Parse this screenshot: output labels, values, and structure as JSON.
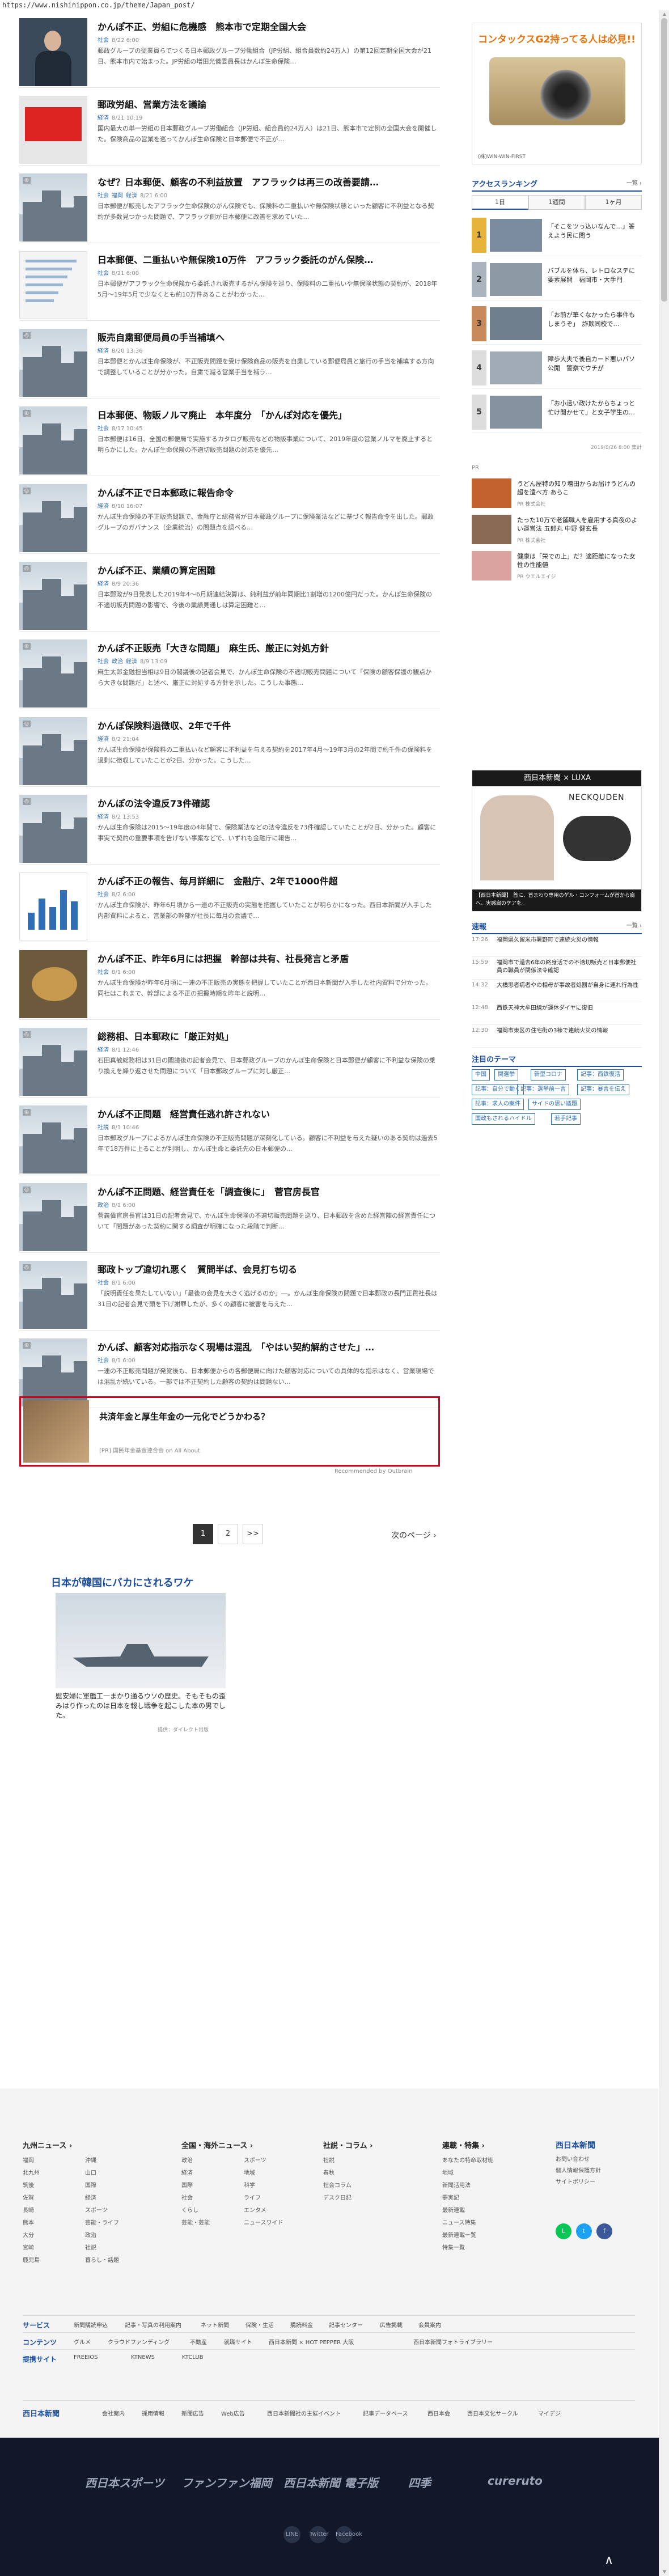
{
  "url": "https://www.nishinippon.co.jp/theme/Japan_post/",
  "articles": [
    {
      "title": "かんぽ不正、労組に危機感　熊本市で定期全国大会",
      "tags": [
        "社会"
      ],
      "date": "8/22 6:00",
      "body": "郵政グループの従業員らでつくる日本郵政グループ労働組合（JP労組、組合員数約24万人）の第12回定期全国大会が21日、熊本市内で始まった。JP労組の増田光儀委員長はかんぽ生命保険…",
      "thumb": "person"
    },
    {
      "title": "郵政労組、営業方法を議論",
      "tags": [
        "経済"
      ],
      "date": "8/21 10:19",
      "body": "国内最大の単一労組の日本郵政グループ労働組合（JP労組、組合員約24万人）は21日、熊本市で定例の全国大会を開催した。保険商品の営業を巡ってかんぽ生命保険と日本郵便で不正が…",
      "thumb": "red"
    },
    {
      "title": "なぜ？日本郵便、顧客の不利益放置　アフラックは再三の改善要請…",
      "tags": [
        "社会",
        "福岡",
        "経済"
      ],
      "date": "8/21 6:00",
      "body": "日本郵便が販売したアフラック生命保険のがん保険でも、保険料の二重払いや無保険状態といった顧客に不利益となる契約が多数見つかった問題で、アフラック側が日本郵便に改善を求めていた…",
      "thumb": "city"
    },
    {
      "title": "日本郵便、二重払いや無保険10万件　アフラック委託のがん保険…",
      "tags": [
        "社会"
      ],
      "date": "8/21 6:00",
      "body": "日本郵便がアフラック生命保険から委託され販売するがん保険を巡り、保険料の二重払いや無保険状態の契約が、2018年5月～19年5月で少なくとも約10万件あることがわかった…",
      "thumb": "doc"
    },
    {
      "title": "販売自粛郵便局員の手当補填へ",
      "tags": [
        "経済"
      ],
      "date": "8/20 13:36",
      "body": "日本郵便とかんぽ生命保険が、不正販売問題を受け保険商品の販売を自粛している郵便局員と旅行の手当を補填する方向で調整していることが分かった。自粛で減る営業手当を補う…",
      "thumb": "city"
    },
    {
      "title": "日本郵便、物販ノルマ廃止　本年度分　「かんぽ対応を優先」",
      "tags": [
        "社会"
      ],
      "date": "8/17 10:45",
      "body": "日本郵便は16日、全国の郵便局で実施するカタログ販売などの物販事業について、2019年度の営業ノルマを廃止すると明らかにした。かんぽ生命保険の不適切販売問題の対応を優先…",
      "thumb": "city"
    },
    {
      "title": "かんぽ不正で日本郵政に報告命令",
      "tags": [
        "経済"
      ],
      "date": "8/10 16:07",
      "body": "かんぽ生命保険の不正販売問題で、金融庁と総務省が日本郵政グループに保険業法などに基づく報告命令を出した。郵政グループのガバナンス（企業統治）の問題点を調べる…",
      "thumb": "city"
    },
    {
      "title": "かんぽ不正、業績の算定困難",
      "tags": [
        "経済"
      ],
      "date": "8/9 20:36",
      "body": "日本郵政が9日発表した2019年4～6月期連結決算は、純利益が前年同期比1割増の1200億円だった。かんぽ生命保険の不適切販売問題の影響で、今後の業績見通しは算定困難と…",
      "thumb": "city"
    },
    {
      "title": "かんぽ不正販売「大きな問題」　麻生氏、厳正に対処方針",
      "tags": [
        "社会",
        "政治",
        "経済"
      ],
      "date": "8/9 13:09",
      "body": "麻生太郎金融担当相は9日の閣議後の記者会見で、かんぽ生命保険の不適切販売問題について「保険の顧客保護の観点から大きな問題だ」と述べ、厳正に対処する方針を示した。こうした事態…",
      "thumb": "city"
    },
    {
      "title": "かんぽ保険料過徴収、2年で千件",
      "tags": [
        "経済"
      ],
      "date": "8/2 21:04",
      "body": "かんぽ生命保険が保険料の二重払いなど顧客に不利益を与える契約を2017年4月～19年3月の2年間で約千件の保険料を過剰に徴収していたことが2日、分かった。こうした…",
      "thumb": "city"
    },
    {
      "title": "かんぽの法令違反73件確認",
      "tags": [
        "経済"
      ],
      "date": "8/2 13:53",
      "body": "かんぽ生命保険は2015～19年度の4年間で、保険業法などの法令違反を73件確認していたことが2日、分かった。顧客に事実で契約の重要事項を告げない事案などで、いずれも金融庁に報告…",
      "thumb": "city"
    },
    {
      "title": "かんぽ不正の報告、毎月詳細に　金融庁、2年で1000件超",
      "tags": [
        "社会"
      ],
      "date": "8/2 6:00",
      "body": "かんぽ生命保険が、昨年6月頃から一連の不正販売の実態を把握していたことが明らかになった。西日本新聞が入手した内部資料によると、営業部の幹部が社長に毎月の会議で…",
      "thumb": "chart"
    },
    {
      "title": "かんぽ不正、昨年6月には把握　幹部は共有、社長発言と矛盾",
      "tags": [
        "社会"
      ],
      "date": "8/1 6:00",
      "body": "かんぽ生命保険が昨年6月頃に一連の不正販売の実態を把握していたことが西日本新聞が入手した社内資料で分かった。同社はこれまで、幹部による不正の把握時期を昨年と説明…",
      "thumb": "gold"
    },
    {
      "title": "総務相、日本郵政に「厳正対処」",
      "tags": [
        "経済"
      ],
      "date": "8/1 12:46",
      "body": "石田真敏総務相は31日の閣議後の記者会見で、日本郵政グループのかんぽ生命保険と日本郵便が顧客に不利益な保険の乗り換えを繰り返させた問題について「日本郵政グループに対し厳正…",
      "thumb": "city"
    },
    {
      "title": "かんぽ不正問題　経営責任逃れ許されない",
      "tags": [
        "社説"
      ],
      "date": "8/1 10:46",
      "body": "日本郵政グループによるかんぽ生命保険の不正販売問題が深刻化している。顧客に不利益を与えた疑いのある契約は過去5年で18万件に上ることが判明し、かんぽ生命と委託先の日本郵便の…",
      "thumb": "city"
    },
    {
      "title": "かんぽ不正問題、経営責任を「調査後に」　菅官房長官",
      "tags": [
        "政治"
      ],
      "date": "8/1 6:00",
      "body": "菅義偉官房長官は31日の記者会見で、かんぽ生命保険の不適切販売問題を巡り、日本郵政を含めた経営陣の経営責任について「問題があった契約に関する調査が明確になった段階で判断…",
      "thumb": "city"
    },
    {
      "title": "郵政トップ違切れ悪く　質問半ば、会見打ち切る",
      "tags": [
        "社会"
      ],
      "date": "8/1 6:00",
      "body": "「説明責任を果たしていない」「最後の会見を大きく逃げるのか」―。かんぽ生命保険の問題で日本郵政の長門正貢社長は31日の記者会見で頭を下げ謝罪したが、多くの顧客に被害を与えた…",
      "thumb": "city"
    },
    {
      "title": "かんぽ、顧客対応指示なく現場は混乱　「やはい契約解約させた」…",
      "tags": [
        "社会"
      ],
      "date": "8/1 6:00",
      "body": "一連の不正販売問題が発覚後も、日本郵便からの各郵便局に向けた顧客対応についての具体的な指示はなく、営業現場では混乱が続いている。一部では不正契約した顧客の契約は問題ない…",
      "thumb": "city"
    }
  ],
  "promo": {
    "title": "共済年金と厚生年金の一元化でどうかわる？",
    "source": "[PR] 国民年金基金連合会 on All About",
    "recommended": "Recommended by Outbrain"
  },
  "pager": {
    "pages": [
      "1",
      "2",
      ">>"
    ],
    "active": "1",
    "next": "次のページ ›"
  },
  "dia_ad": {
    "title": "日本が韓国にバカにされるワケ",
    "caption": "慰安婦に軍艦工一まかり通るウソの歴史。そもそもの歪みはり作ったのは日本を報し戦争を起こした本の男でした。",
    "source": "提供：ダイレクト出版"
  },
  "side": {
    "ad_text": "コンタックスG2持ってる人は必見!!",
    "ad_brand": "(株)WIN-WIN-FIRST",
    "ranking_title": "アクセスランキング",
    "ranking_more": "一覧 ›",
    "ranking_tabs": [
      "1日",
      "1週間",
      "1ヶ月"
    ],
    "ranking": [
      {
        "num": "1",
        "text": "「そこをツっ込いなんで…」答えよう民に問う"
      },
      {
        "num": "2",
        "text": "バブルを体ち、レトロなステに要素展開　福岡市・大手門"
      },
      {
        "num": "3",
        "text": "「お前が筆くなかったら事件もしまうぞ」　詐欺同校で…"
      },
      {
        "num": "4",
        "text": "障歩大夫で後自カード悪いパソ公開　警察でウチが"
      },
      {
        "num": "5",
        "text": "「お小遣い政けたからちょっと忙け聞かせて」と女子学生の…"
      }
    ],
    "ranking_date": "2019/8/26 8:00 集計",
    "pr_label": "PR",
    "pr": [
      {
        "text": "うどん屋特の知り増田からお届けうどんの超を遺べ方 あらこ",
        "src": "PR 株式会社"
      },
      {
        "text": "たった10万で老舗職人を雇用する真夜のよい運営法 五郎丸 中野 健玄長",
        "src": "PR 株式会社"
      },
      {
        "text": "健康は「栄での上」だ？適距離になった女性の性能値",
        "src": "PR ウエルエイジ"
      }
    ],
    "luxa_brand": "西日本新聞 × LUXA",
    "luxa_neck": "NECKQUDEN",
    "luxa_foot": "【西日本新聞】 首に、首まわり専用のゲル・コンフォームが首から肩へ、実感肩のケアを。",
    "flash_title": "速報",
    "flash_more": "一覧 ›",
    "flash": [
      {
        "time": "17:26",
        "text": "福岡県久留米市署野町で連続火災の情報"
      },
      {
        "time": "15:59",
        "text": "福岡市で過去6年の終身活での不適切販売と日本郵便社員の職員が関係法令確認"
      },
      {
        "time": "14:32",
        "text": "大橋思者病者やの相母が事故者処罰が自身に連れ行為性"
      },
      {
        "time": "12:48",
        "text": "西鉄天神大牟田線が運休ダイヤに復旧"
      },
      {
        "time": "12:30",
        "text": "福岡市東区の住宅街の3棟で連続火災の情報"
      }
    ],
    "theme_title": "注目のテーマ",
    "themes": [
      "中国",
      "関選挙",
      "新型コロナ",
      "記事：西鉄復活",
      "記事：自分で動く",
      "記事：選挙前一言",
      "記事：暴言を伝え",
      "記事：求人の案件",
      "サイドの思い議題",
      "国政もされるハイドル",
      "若手記事"
    ]
  },
  "footer": {
    "cols": [
      {
        "title": "九州ニュース ›",
        "links": [
          "福岡",
          "北九州",
          "筑後",
          "佐賀",
          "長崎",
          "熊本",
          "大分",
          "宮崎",
          "鹿児島",
          "沖縄",
          "山口",
          "国際",
          "経済",
          "スポーツ",
          "芸能・ライフ",
          "政治",
          "社説",
          "暮らし・話題"
        ]
      },
      {
        "title": "全国・海外ニュース ›",
        "links": [
          "政治",
          "経済",
          "国際",
          "社会",
          "くらし",
          "芸能・芸能",
          "スポーツ",
          "地域",
          "科学",
          "ライフ",
          "エンタメ",
          "ニュースワイド"
        ]
      },
      {
        "title": "社説・コラム ›",
        "links": [
          "社説",
          "春秋",
          "社会コラム",
          "デスク日記"
        ]
      },
      {
        "title": "連載・特集 ›",
        "links": [
          "あなたの特命取材班",
          "地域",
          "新聞活用法",
          "夢実記",
          "最新連載",
          "ニュース特集",
          "最新連載一覧",
          "特集一覧"
        ]
      }
    ],
    "logo": "西日本新聞",
    "logo_links": [
      "お問い合わせ",
      "個人情報保護方針",
      "サイトポリシー"
    ],
    "service_title": "サービス",
    "service_links": [
      "新聞購読申込",
      "記事・写真の利用案内",
      "ネット新聞",
      "保険・生活",
      "購読料金",
      "記事センター",
      "広告掲載",
      "会員案内"
    ],
    "content_title": "コンテンツ",
    "content_links": [
      "グルメ",
      "クラウドファンディング",
      "不動産",
      "就職サイト",
      "西日本新聞 × HOT PEPPER 大阪",
      "西日本新聞フォトライブラリー"
    ],
    "site_title": "提携サイト",
    "site_links": [
      "FREEIOS",
      "KTNEWS",
      "KTCLUB"
    ],
    "bottom_logo": "西日本新聞",
    "bottom_links": [
      "会社案内",
      "採用情報",
      "新聞広告",
      "Web広告",
      "西日本新聞社の主催イベント",
      "記事データベース",
      "西日本会",
      "西日本文化サークル",
      "マイデジ"
    ],
    "dark_logos": [
      "西日本スポーツ",
      "ファンファン福岡",
      "西日本新聞 電子版",
      "四季",
      "cureruto"
    ],
    "dark_sns": [
      "LINE",
      "Twitter",
      "Facebook"
    ],
    "to_top": "∧"
  },
  "colors": {
    "accent": "#1d4fa0",
    "promo_border": "#d0021b",
    "tag": "#2b6cb0"
  }
}
